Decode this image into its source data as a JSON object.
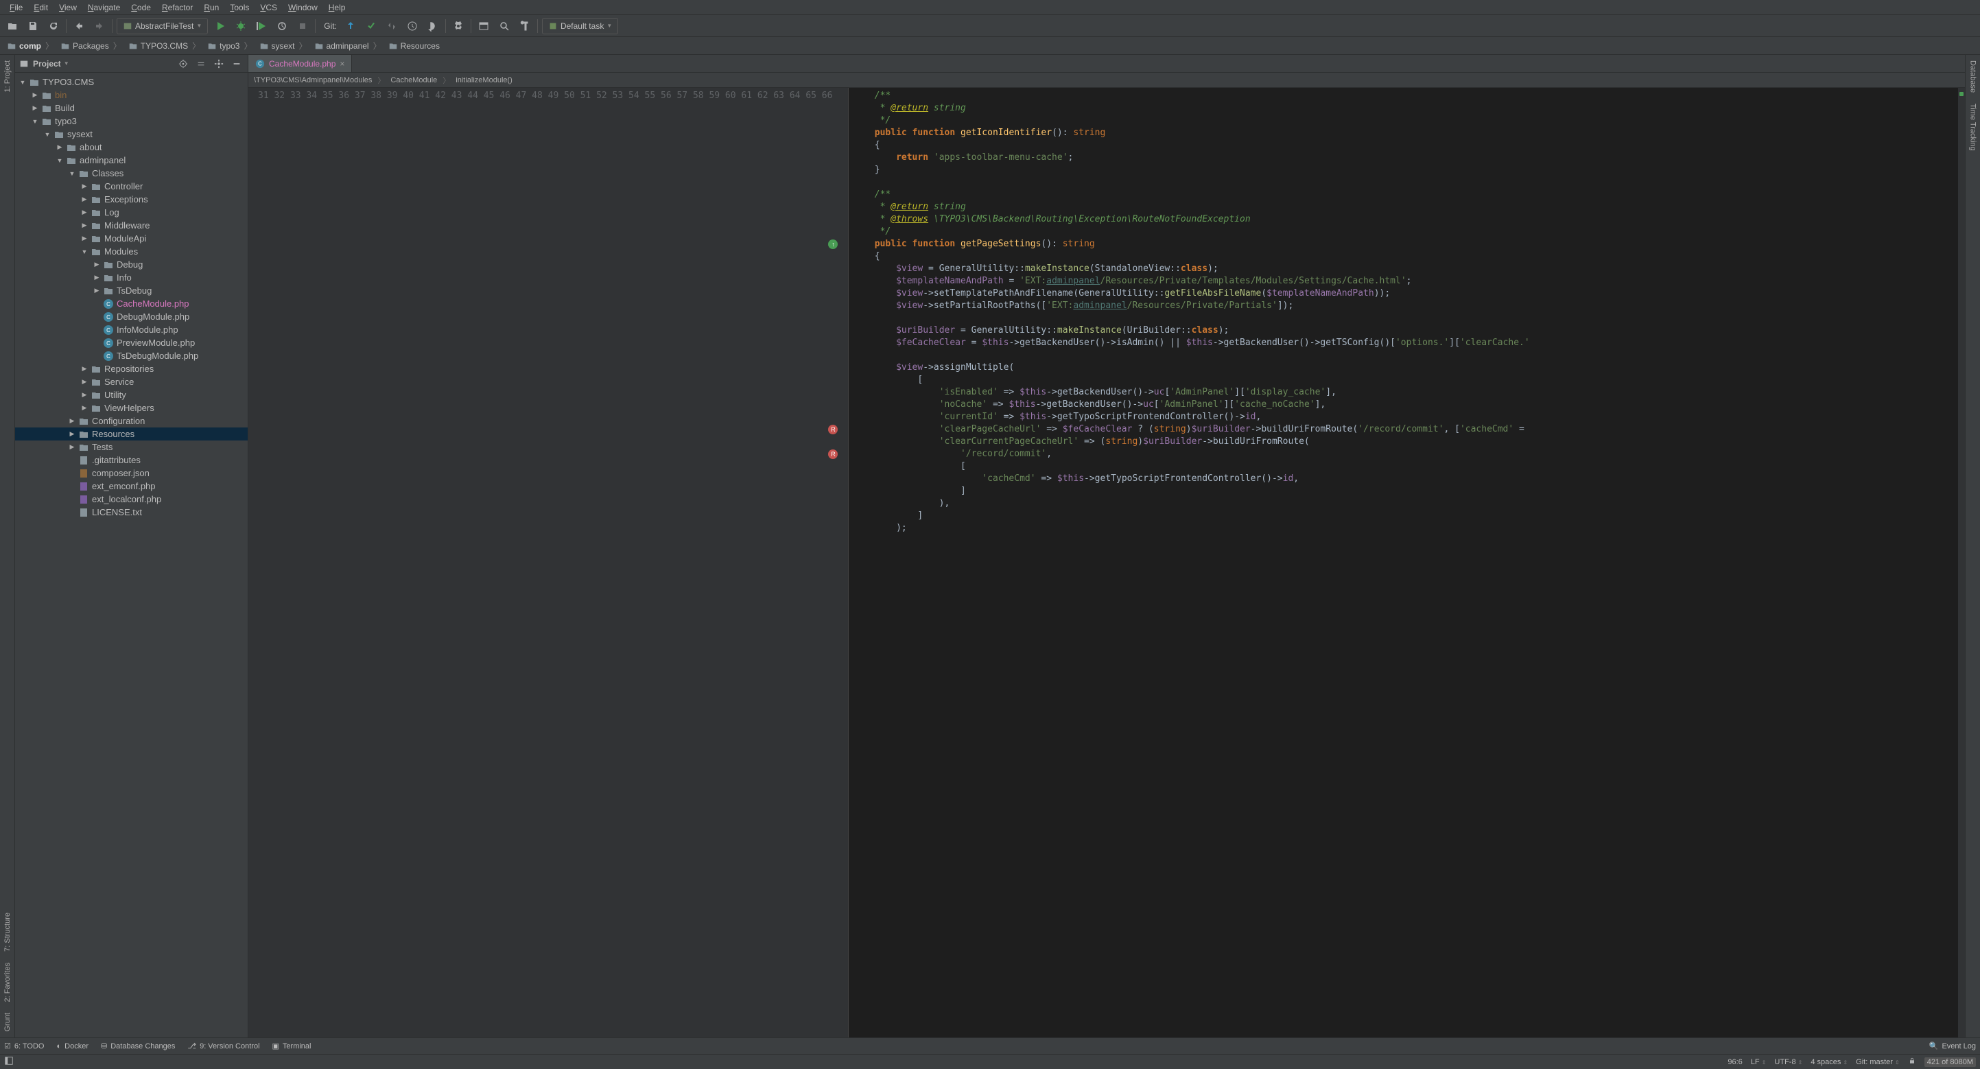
{
  "menubar": [
    "File",
    "Edit",
    "View",
    "Navigate",
    "Code",
    "Refactor",
    "Run",
    "Tools",
    "VCS",
    "Window",
    "Help"
  ],
  "toolbar": {
    "run_config": "AbstractFileTest",
    "git_label": "Git:",
    "default_task": "Default task"
  },
  "breadcrumbs": [
    {
      "label": "comp",
      "bold": true
    },
    {
      "label": "Packages"
    },
    {
      "label": "TYPO3.CMS"
    },
    {
      "label": "typo3"
    },
    {
      "label": "sysext"
    },
    {
      "label": "adminpanel"
    },
    {
      "label": "Resources"
    }
  ],
  "left_gutter": [
    {
      "key": "project",
      "label": "1: Project"
    }
  ],
  "left_gutter_bottom": [
    {
      "key": "structure",
      "label": "7: Structure"
    },
    {
      "key": "favorites",
      "label": "2: Favorites"
    },
    {
      "key": "grunt",
      "label": "Grunt"
    }
  ],
  "right_gutter": [
    {
      "key": "database",
      "label": "Database"
    },
    {
      "key": "timetracking",
      "label": "Time Tracking"
    }
  ],
  "project_panel": {
    "title": "Project"
  },
  "tree": [
    {
      "depth": 0,
      "arrow": "▼",
      "icon": "folder",
      "label": "TYPO3.CMS"
    },
    {
      "depth": 1,
      "arrow": "▶",
      "icon": "folder",
      "label": "bin",
      "dim": true
    },
    {
      "depth": 1,
      "arrow": "▶",
      "icon": "folder",
      "label": "Build"
    },
    {
      "depth": 1,
      "arrow": "▼",
      "icon": "folder",
      "label": "typo3"
    },
    {
      "depth": 2,
      "arrow": "▼",
      "icon": "folder",
      "label": "sysext"
    },
    {
      "depth": 3,
      "arrow": "▶",
      "icon": "folder",
      "label": "about"
    },
    {
      "depth": 3,
      "arrow": "▼",
      "icon": "folder",
      "label": "adminpanel"
    },
    {
      "depth": 4,
      "arrow": "▼",
      "icon": "folder",
      "label": "Classes"
    },
    {
      "depth": 5,
      "arrow": "▶",
      "icon": "folder",
      "label": "Controller"
    },
    {
      "depth": 5,
      "arrow": "▶",
      "icon": "folder",
      "label": "Exceptions"
    },
    {
      "depth": 5,
      "arrow": "▶",
      "icon": "folder",
      "label": "Log"
    },
    {
      "depth": 5,
      "arrow": "▶",
      "icon": "folder",
      "label": "Middleware"
    },
    {
      "depth": 5,
      "arrow": "▶",
      "icon": "folder",
      "label": "ModuleApi"
    },
    {
      "depth": 5,
      "arrow": "▼",
      "icon": "folder",
      "label": "Modules"
    },
    {
      "depth": 6,
      "arrow": "▶",
      "icon": "folder",
      "label": "Debug"
    },
    {
      "depth": 6,
      "arrow": "▶",
      "icon": "folder",
      "label": "Info"
    },
    {
      "depth": 6,
      "arrow": "▶",
      "icon": "folder",
      "label": "TsDebug"
    },
    {
      "depth": 6,
      "arrow": "",
      "icon": "php",
      "label": "CacheModule.php",
      "pink": true
    },
    {
      "depth": 6,
      "arrow": "",
      "icon": "php",
      "label": "DebugModule.php"
    },
    {
      "depth": 6,
      "arrow": "",
      "icon": "php",
      "label": "InfoModule.php"
    },
    {
      "depth": 6,
      "arrow": "",
      "icon": "php",
      "label": "PreviewModule.php"
    },
    {
      "depth": 6,
      "arrow": "",
      "icon": "php",
      "label": "TsDebugModule.php"
    },
    {
      "depth": 5,
      "arrow": "▶",
      "icon": "folder",
      "label": "Repositories"
    },
    {
      "depth": 5,
      "arrow": "▶",
      "icon": "folder",
      "label": "Service"
    },
    {
      "depth": 5,
      "arrow": "▶",
      "icon": "folder",
      "label": "Utility"
    },
    {
      "depth": 5,
      "arrow": "▶",
      "icon": "folder",
      "label": "ViewHelpers"
    },
    {
      "depth": 4,
      "arrow": "▶",
      "icon": "folder",
      "label": "Configuration"
    },
    {
      "depth": 4,
      "arrow": "▶",
      "icon": "folder",
      "label": "Resources",
      "sel": true
    },
    {
      "depth": 4,
      "arrow": "▶",
      "icon": "folder",
      "label": "Tests"
    },
    {
      "depth": 4,
      "arrow": "",
      "icon": "file",
      "label": ".gitattributes"
    },
    {
      "depth": 4,
      "arrow": "",
      "icon": "json",
      "label": "composer.json"
    },
    {
      "depth": 4,
      "arrow": "",
      "icon": "phpsrc",
      "label": "ext_emconf.php"
    },
    {
      "depth": 4,
      "arrow": "",
      "icon": "phpsrc",
      "label": "ext_localconf.php"
    },
    {
      "depth": 4,
      "arrow": "",
      "icon": "txt",
      "label": "LICENSE.txt"
    }
  ],
  "editor": {
    "tab_name": "CacheModule.php",
    "crumb": [
      "\\TYPO3\\CMS\\Adminpanel\\Modules",
      "CacheModule",
      "initializeModule()"
    ],
    "first_line": 31,
    "lines": [
      {
        "n": 31,
        "html": "    <span class='cm'>/**</span>"
      },
      {
        "n": 32,
        "html": "    <span class='cm'> * <span class='tg'>@return</span> string</span>"
      },
      {
        "n": 33,
        "html": "    <span class='cm'> */</span>"
      },
      {
        "n": 34,
        "html": "    <span class='kw'>public function</span> <span class='fn'>getIconIdentifier</span>(): <span class='tp'>string</span>"
      },
      {
        "n": 35,
        "html": "    {"
      },
      {
        "n": 36,
        "html": "        <span class='kw'>return</span> <span class='str'>'apps-toolbar-menu-cache'</span>;"
      },
      {
        "n": 37,
        "html": "    }"
      },
      {
        "n": 38,
        "html": ""
      },
      {
        "n": 39,
        "html": "    <span class='cm'>/**</span>"
      },
      {
        "n": 40,
        "html": "    <span class='cm'> * <span class='tg'>@return</span> string</span>"
      },
      {
        "n": 41,
        "html": "    <span class='cm'> * <span class='tg'>@throws</span> \\TYPO3\\CMS\\Backend\\Routing\\Exception\\RouteNotFoundException</span>"
      },
      {
        "n": 42,
        "html": "    <span class='cm'> */</span>"
      },
      {
        "n": 43,
        "html": "    <span class='kw'>public function</span> <span class='fn'>getPageSettings</span>(): <span class='tp'>string</span>"
      },
      {
        "n": 44,
        "html": "    {"
      },
      {
        "n": 45,
        "html": "        <span class='var'>$view</span> = GeneralUtility::<span class='cl'>makeInstance</span>(StandaloneView::<span class='kw'>class</span>);"
      },
      {
        "n": 46,
        "html": "        <span class='var'>$templateNameAndPath</span> = <span class='str'>'EXT:<span class='lk'>adminpanel</span>/Resources/Private/Templates/Modules/Settings/Cache.html'</span>;"
      },
      {
        "n": 47,
        "html": "        <span class='var'>$view</span>->setTemplatePathAndFilename(GeneralUtility::<span class='cl'>getFileAbsFileName</span>(<span class='var'>$templateNameAndPath</span>));"
      },
      {
        "n": 48,
        "html": "        <span class='var'>$view</span>->setPartialRootPaths([<span class='str'>'EXT:<span class='lk'>adminpanel</span>/Resources/Private/Partials'</span>]);"
      },
      {
        "n": 49,
        "html": ""
      },
      {
        "n": 50,
        "html": "        <span class='var'>$uriBuilder</span> = GeneralUtility::<span class='cl'>makeInstance</span>(UriBuilder::<span class='kw'>class</span>);"
      },
      {
        "n": 51,
        "html": "        <span class='var'>$feCacheClear</span> = <span class='var'>$this</span>->getBackendUser()->isAdmin() || <span class='var'>$this</span>->getBackendUser()->getTSConfig()[<span class='str'>'options.'</span>][<span class='str'>'clearCache.'</span>"
      },
      {
        "n": 52,
        "html": ""
      },
      {
        "n": 53,
        "html": "        <span class='var'>$view</span>->assignMultiple("
      },
      {
        "n": 54,
        "html": "            ["
      },
      {
        "n": 55,
        "html": "                <span class='str'>'isEnabled'</span> => <span class='var'>$this</span>->getBackendUser()-><span class='var'>uc</span>[<span class='str'>'AdminPanel'</span>][<span class='str'>'display_cache'</span>],"
      },
      {
        "n": 56,
        "html": "                <span class='str'>'noCache'</span> => <span class='var'>$this</span>->getBackendUser()-><span class='var'>uc</span>[<span class='str'>'AdminPanel'</span>][<span class='str'>'cache_noCache'</span>],"
      },
      {
        "n": 57,
        "html": "                <span class='str'>'currentId'</span> => <span class='var'>$this</span>->getTypoScriptFrontendController()-><span class='var'>id</span>,"
      },
      {
        "n": 58,
        "html": "                <span class='str'>'clearPageCacheUrl'</span> => <span class='var'>$feCacheClear</span> ? (<span class='tp'>string</span>)<span class='var'>$uriBuilder</span>->buildUriFromRoute(<span class='str'>'/record/commit'</span>, [<span class='str'>'cacheCmd'</span> ="
      },
      {
        "n": 59,
        "html": "                <span class='str'>'clearCurrentPageCacheUrl'</span> => (<span class='tp'>string</span>)<span class='var'>$uriBuilder</span>->buildUriFromRoute("
      },
      {
        "n": 60,
        "html": "                    <span class='str'>'/record/commit'</span>,"
      },
      {
        "n": 61,
        "html": "                    ["
      },
      {
        "n": 62,
        "html": "                        <span class='str'>'cacheCmd'</span> => <span class='var'>$this</span>->getTypoScriptFrontendController()-><span class='var'>id</span>,"
      },
      {
        "n": 63,
        "html": "                    ]"
      },
      {
        "n": 64,
        "html": "                ),"
      },
      {
        "n": 65,
        "html": "            ]"
      },
      {
        "n": 66,
        "html": "        );"
      }
    ]
  },
  "tool_windows": [
    {
      "key": "todo",
      "label": "6: TODO"
    },
    {
      "key": "docker",
      "label": "Docker"
    },
    {
      "key": "dbchanges",
      "label": "Database Changes"
    },
    {
      "key": "vcs",
      "label": "9: Version Control"
    },
    {
      "key": "terminal",
      "label": "Terminal"
    }
  ],
  "tool_windows_right": [
    {
      "key": "eventlog",
      "label": "Event Log"
    }
  ],
  "statusbar": {
    "caret": "96:6",
    "line_sep": "LF",
    "encoding": "UTF-8",
    "indent": "4 spaces",
    "git": "Git: master",
    "mem": "421 of 8080M"
  }
}
